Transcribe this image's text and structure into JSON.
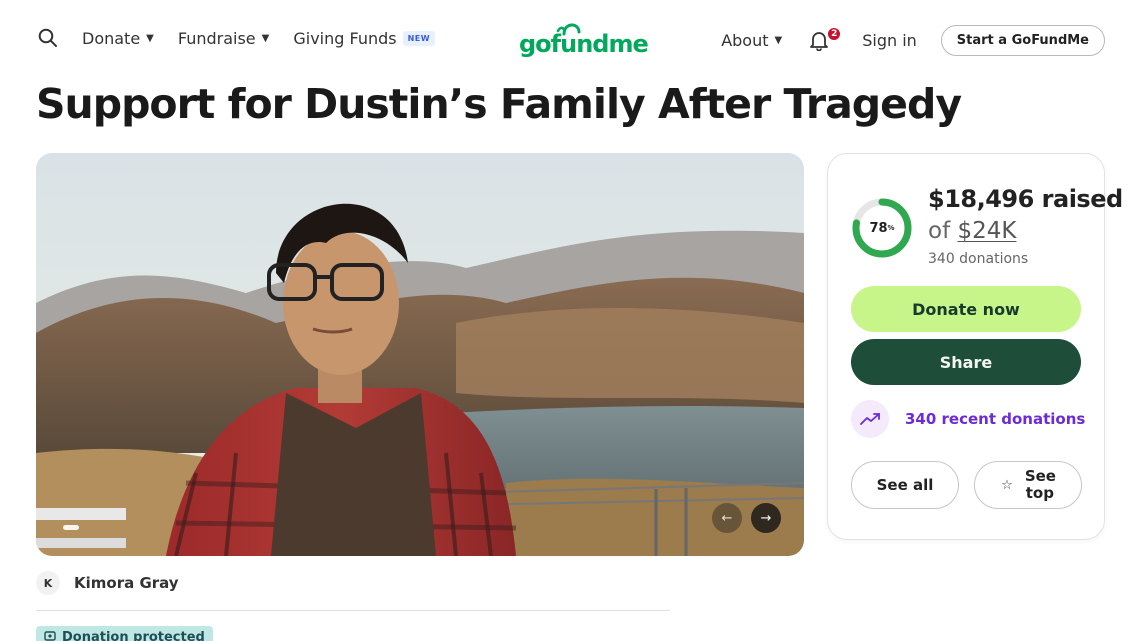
{
  "header": {
    "nav_left": [
      {
        "label": "Donate",
        "has_caret": true
      },
      {
        "label": "Fundraise",
        "has_caret": true
      },
      {
        "label": "Giving Funds",
        "badge": "NEW"
      }
    ],
    "logo": "gofundme",
    "about_label": "About",
    "notifications_count": "2",
    "signin_label": "Sign in",
    "start_label": "Start a GoFundMe"
  },
  "campaign": {
    "title": "Support for Dustin’s Family After Tragedy",
    "organizer_initial": "K",
    "organizer_name": "Kimora Gray",
    "protected_label": "Donation protected"
  },
  "card": {
    "progress_percent": 78,
    "percent_label": "78",
    "percent_symbol": "%",
    "raised_label": "$18,496 raised",
    "goal_prefix": "of",
    "goal_amount": "$24K",
    "donations_label": "340 donations",
    "donate_label": "Donate now",
    "share_label": "Share",
    "recent_label": "340 recent donations",
    "see_all_label": "See all",
    "see_top_label": "See top"
  },
  "colors": {
    "brand_green": "#02a95c",
    "donate_button": "#c8f58a",
    "share_button": "#1e4d3a",
    "recent_accent": "#6c2bd9",
    "progress_track": "#e6e6e6",
    "progress_fill": "#2fa84f"
  }
}
